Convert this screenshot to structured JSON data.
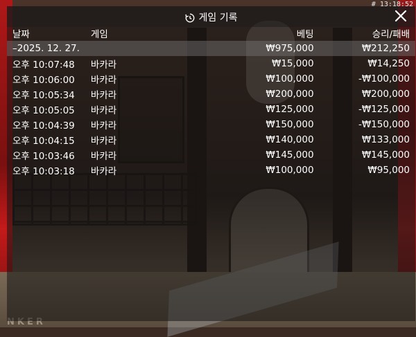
{
  "clock": "# 13:18:52",
  "panel": {
    "title": "게임 기록",
    "history_icon": "history-icon",
    "close_icon": "close-icon"
  },
  "table": {
    "headers": {
      "date": "날짜",
      "game": "게임",
      "bet": "베팅",
      "result": "승리/패배"
    },
    "summary": {
      "date": "–2025. 12. 27.",
      "game": "",
      "bet": "₩975,000",
      "result": "₩212,250"
    },
    "rows": [
      {
        "time": "오후 10:07:48",
        "game": "바카라",
        "bet": "₩15,000",
        "result": "₩14,250"
      },
      {
        "time": "오후 10:06:00",
        "game": "바카라",
        "bet": "₩100,000",
        "result": "-₩100,000"
      },
      {
        "time": "오후 10:05:34",
        "game": "바카라",
        "bet": "₩200,000",
        "result": "₩200,000"
      },
      {
        "time": "오후 10:05:05",
        "game": "바카라",
        "bet": "₩125,000",
        "result": "-₩125,000"
      },
      {
        "time": "오후 10:04:39",
        "game": "바카라",
        "bet": "₩150,000",
        "result": "-₩150,000"
      },
      {
        "time": "오후 10:04:15",
        "game": "바카라",
        "bet": "₩140,000",
        "result": "₩133,000"
      },
      {
        "time": "오후 10:03:46",
        "game": "바카라",
        "bet": "₩145,000",
        "result": "₩145,000"
      },
      {
        "time": "오후 10:03:18",
        "game": "바카라",
        "bet": "₩100,000",
        "result": "₩95,000"
      }
    ]
  }
}
